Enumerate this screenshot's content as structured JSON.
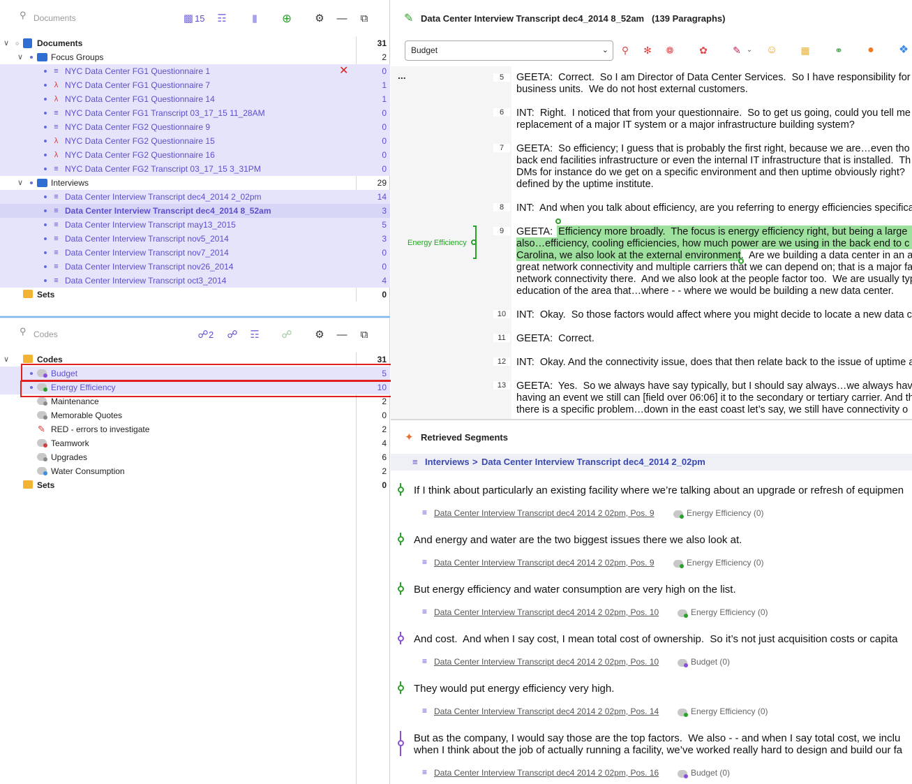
{
  "docs_panel": {
    "search_placeholder": "Documents",
    "doc_count": "15",
    "root": {
      "label": "Documents",
      "count": "31"
    },
    "groups": [
      {
        "label": "Focus Groups",
        "count": "2",
        "items": [
          {
            "label": "NYC Data Center FG1 Questionnaire 1",
            "count": "0",
            "icon": "text"
          },
          {
            "label": "NYC Data Center FG1 Questionnaire 7",
            "count": "1",
            "icon": "pdf"
          },
          {
            "label": "NYC Data Center FG1 Questionnaire 14",
            "count": "1",
            "icon": "pdf"
          },
          {
            "label": "NYC Data Center FG1 Transcript 03_17_15 11_28AM",
            "count": "0",
            "icon": "text"
          },
          {
            "label": "NYC Data Center FG2 Questionnaire 9",
            "count": "0",
            "icon": "text"
          },
          {
            "label": "NYC Data Center FG2 Questionnaire 15",
            "count": "0",
            "icon": "pdf"
          },
          {
            "label": "NYC Data Center FG2 Questionnaire 16",
            "count": "0",
            "icon": "pdf"
          },
          {
            "label": "NYC Data Center FG2 Transcript 03_17_15 3_31PM",
            "count": "0",
            "icon": "text"
          }
        ]
      },
      {
        "label": "Interviews",
        "count": "29",
        "items": [
          {
            "label": "Data Center Interview Transcript dec4_2014 2_02pm",
            "count": "14",
            "icon": "text"
          },
          {
            "label": "Data Center Interview Transcript dec4_2014 8_52am",
            "count": "3",
            "icon": "text"
          },
          {
            "label": "Data Center Interview Transcript may13_2015",
            "count": "5",
            "icon": "text"
          },
          {
            "label": "Data Center Interview Transcript nov5_2014",
            "count": "3",
            "icon": "text"
          },
          {
            "label": "Data Center Interview Transcript nov7_2014",
            "count": "0",
            "icon": "text"
          },
          {
            "label": "Data Center Interview Transcript nov26_2014",
            "count": "0",
            "icon": "text"
          },
          {
            "label": "Data Center Interview Transcript oct3_2014",
            "count": "4",
            "icon": "text"
          }
        ]
      }
    ],
    "sets": {
      "label": "Sets",
      "count": "0"
    }
  },
  "codes_panel": {
    "search_placeholder": "Codes",
    "code_count": "2",
    "root": {
      "label": "Codes",
      "count": "31"
    },
    "items": [
      {
        "label": "Budget",
        "count": "5",
        "color": "#8a4fd8"
      },
      {
        "label": "Energy Efficiency",
        "count": "10",
        "color": "#2aa12a"
      },
      {
        "label": "Maintenance",
        "count": "2",
        "color": "#9a9a9a"
      },
      {
        "label": "Memorable Quotes",
        "count": "0",
        "color": "#9a9a9a"
      },
      {
        "label": "RED - errors to investigate",
        "count": "2",
        "color": "#d23b3b"
      },
      {
        "label": "Teamwork",
        "count": "4",
        "color": "#9a9a9a"
      },
      {
        "label": "Upgrades",
        "count": "6",
        "color": "#9a9a9a"
      },
      {
        "label": "Water Consumption",
        "count": "2",
        "color": "#9a9a9a"
      }
    ],
    "sets": {
      "label": "Sets",
      "count": "0"
    }
  },
  "document": {
    "title": "Data Center Interview Transcript dec4_2014 8_52am",
    "paragraphs_label": "(139 Paragraphs)",
    "selected_code": "Budget",
    "margin_code": "Energy Efficiency",
    "ellipsis": "...",
    "paragraphs": [
      {
        "num": "5",
        "lines": [
          "GEETA:  Correct.  So I am Director of Data Center Services.  So I have responsibility for",
          "business units.  We do not host external customers."
        ]
      },
      {
        "num": "6",
        "lines": [
          "INT:  Right.  I noticed that from your questionnaire.  So to get us going, could you tell me",
          "replacement of a major IT system or a major infrastructure building system?"
        ]
      },
      {
        "num": "7",
        "lines": [
          "GEETA:  So efficiency; I guess that is probably the first right, because we are…even tho",
          "back end facilities infrastructure or even the internal IT infrastructure that is installed.  Th",
          "DMs for instance do we get on a specific environment and then uptime obviously right?",
          "defined by the uptime institute."
        ]
      },
      {
        "num": "8",
        "lines": [
          "INT:  And when you talk about efficiency, are you referring to energy efficiencies specifica"
        ]
      },
      {
        "num": "9",
        "lines": [
          "GEETA:  Efficiency more broadly.  The focus is energy efficiency right, but being a large",
          "also…efficiency, cooling efficiencies, how much power are we using in the back end to c",
          "Carolina, we also look at the external environment.  Are we building a data center in an a",
          "great network connectivity and multiple carriers that we can depend on; that is a major fa",
          "network connectivity there.  And we also look at the people factor too.  We are usually typ",
          "education of the area that…where - - where we would be building a new data center."
        ]
      },
      {
        "num": "10",
        "lines": [
          "INT:  Okay.  So those factors would affect where you might decide to locate a new data c"
        ]
      },
      {
        "num": "11",
        "lines": [
          "GEETA:  Correct."
        ]
      },
      {
        "num": "12",
        "lines": [
          "INT:  Okay. And the connectivity issue, does that then relate back to the issue of uptime a"
        ]
      },
      {
        "num": "13",
        "lines": [
          "GEETA:  Yes.  So we always have say typically, but I should say always…we always hav",
          "having an event we still can [field over 06:06] it to the secondary or tertiary carrier. And th",
          "there is a specific problem…down in the east coast let’s say, we still have connectivity o"
        ]
      }
    ]
  },
  "retrieved": {
    "header": "Retrieved Segments",
    "breadcrumb_group": "Interviews",
    "breadcrumb_sep": ">",
    "breadcrumb_doc": "Data Center Interview Transcript dec4_2014 2_02pm",
    "segments": [
      {
        "lines": [
          "If I think about particularly an existing facility where we’re talking about an upgrade or refresh of equipmen"
        ],
        "link": "Data Center Interview Transcript dec4 2014 2 02pm, Pos. 9",
        "code": "Energy Efficiency (0)",
        "color": "green"
      },
      {
        "lines": [
          "And energy and water are the two biggest issues there we also look at."
        ],
        "link": "Data Center Interview Transcript dec4 2014 2 02pm, Pos. 9",
        "code": "Energy Efficiency (0)",
        "color": "green"
      },
      {
        "lines": [
          "But energy efficiency and water consumption are very high on the list."
        ],
        "link": "Data Center Interview Transcript dec4 2014 2 02pm, Pos. 10",
        "code": "Energy Efficiency (0)",
        "color": "green"
      },
      {
        "lines": [
          "And cost.  And when I say cost, I mean total cost of ownership.  So it’s not just acquisition costs or capita"
        ],
        "link": "Data Center Interview Transcript dec4 2014 2 02pm, Pos. 10",
        "code": "Budget (0)",
        "color": "purple"
      },
      {
        "lines": [
          "They would put energy efficiency very high."
        ],
        "link": "Data Center Interview Transcript dec4 2014 2 02pm, Pos. 14",
        "code": "Energy Efficiency (0)",
        "color": "green"
      },
      {
        "lines": [
          "But as the company, I would say those are the top factors.  We also - - and when I say total cost, we inclu",
          "when I think about the job of actually running a facility, we’ve worked really hard to design and build our fa"
        ],
        "link": "Data Center Interview Transcript dec4 2014 2 02pm, Pos. 16",
        "code": "Budget (0)",
        "color": "purple"
      }
    ]
  },
  "colors": {
    "accent": "#5a4fcf",
    "green": "#2aa12a",
    "purple": "#8a4fd8",
    "highlight": "#9ee09e",
    "red": "#e0201e"
  }
}
